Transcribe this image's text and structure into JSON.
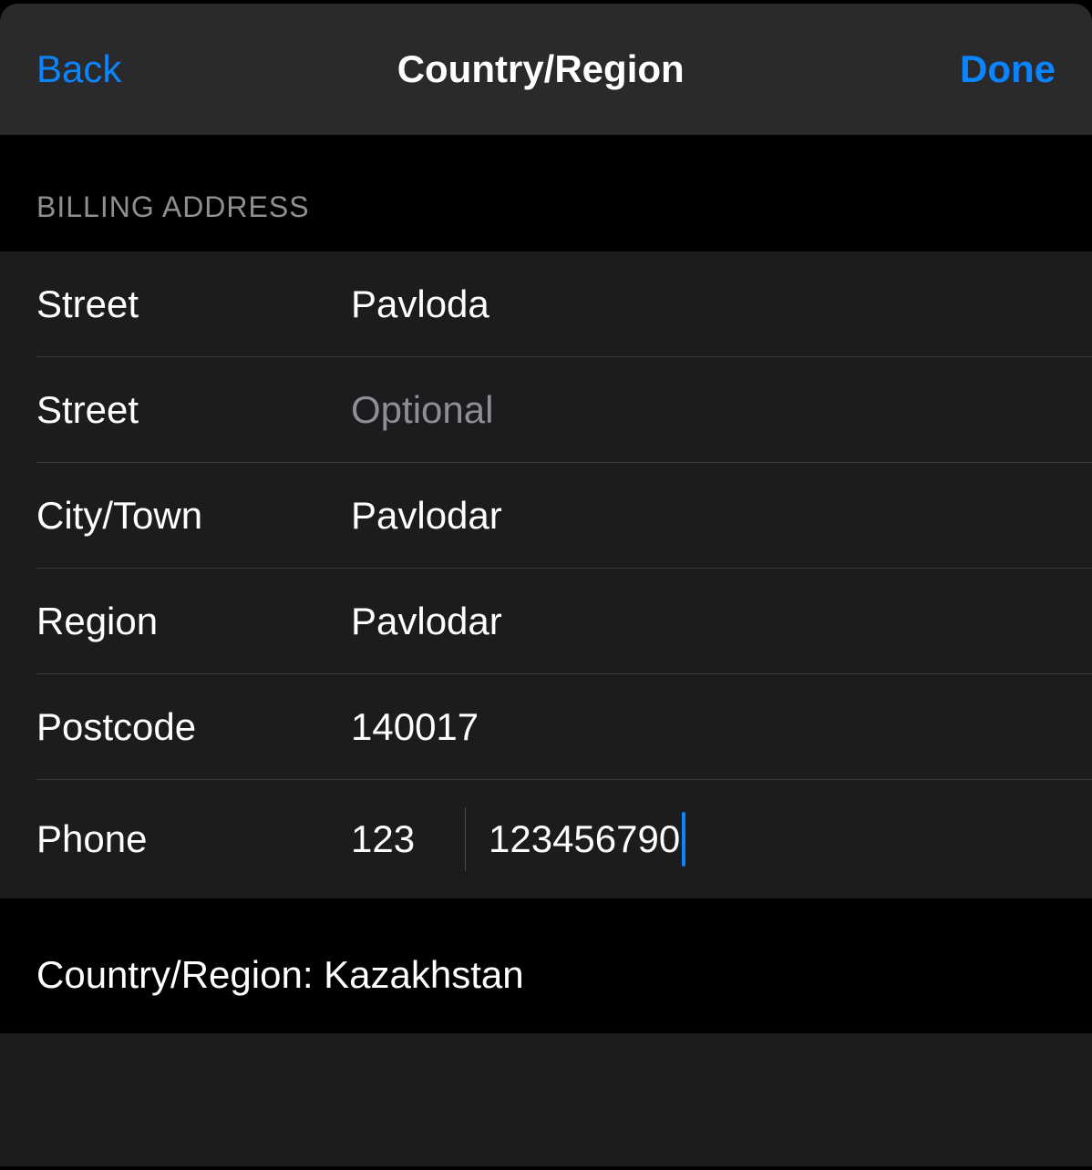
{
  "header": {
    "back_label": "Back",
    "title": "Country/Region",
    "done_label": "Done"
  },
  "section_title": "BILLING ADDRESS",
  "fields": {
    "street1": {
      "label": "Street",
      "value": "Pavloda"
    },
    "street2": {
      "label": "Street",
      "value": "",
      "placeholder": "Optional"
    },
    "city": {
      "label": "City/Town",
      "value": "Pavlodar"
    },
    "region": {
      "label": "Region",
      "value": "Pavlodar"
    },
    "postcode": {
      "label": "Postcode",
      "value": "140017"
    },
    "phone": {
      "label": "Phone",
      "code": "123",
      "number": "123456790"
    }
  },
  "footer": {
    "country_label": "Country/Region: ",
    "country_value": "Kazakhstan"
  }
}
